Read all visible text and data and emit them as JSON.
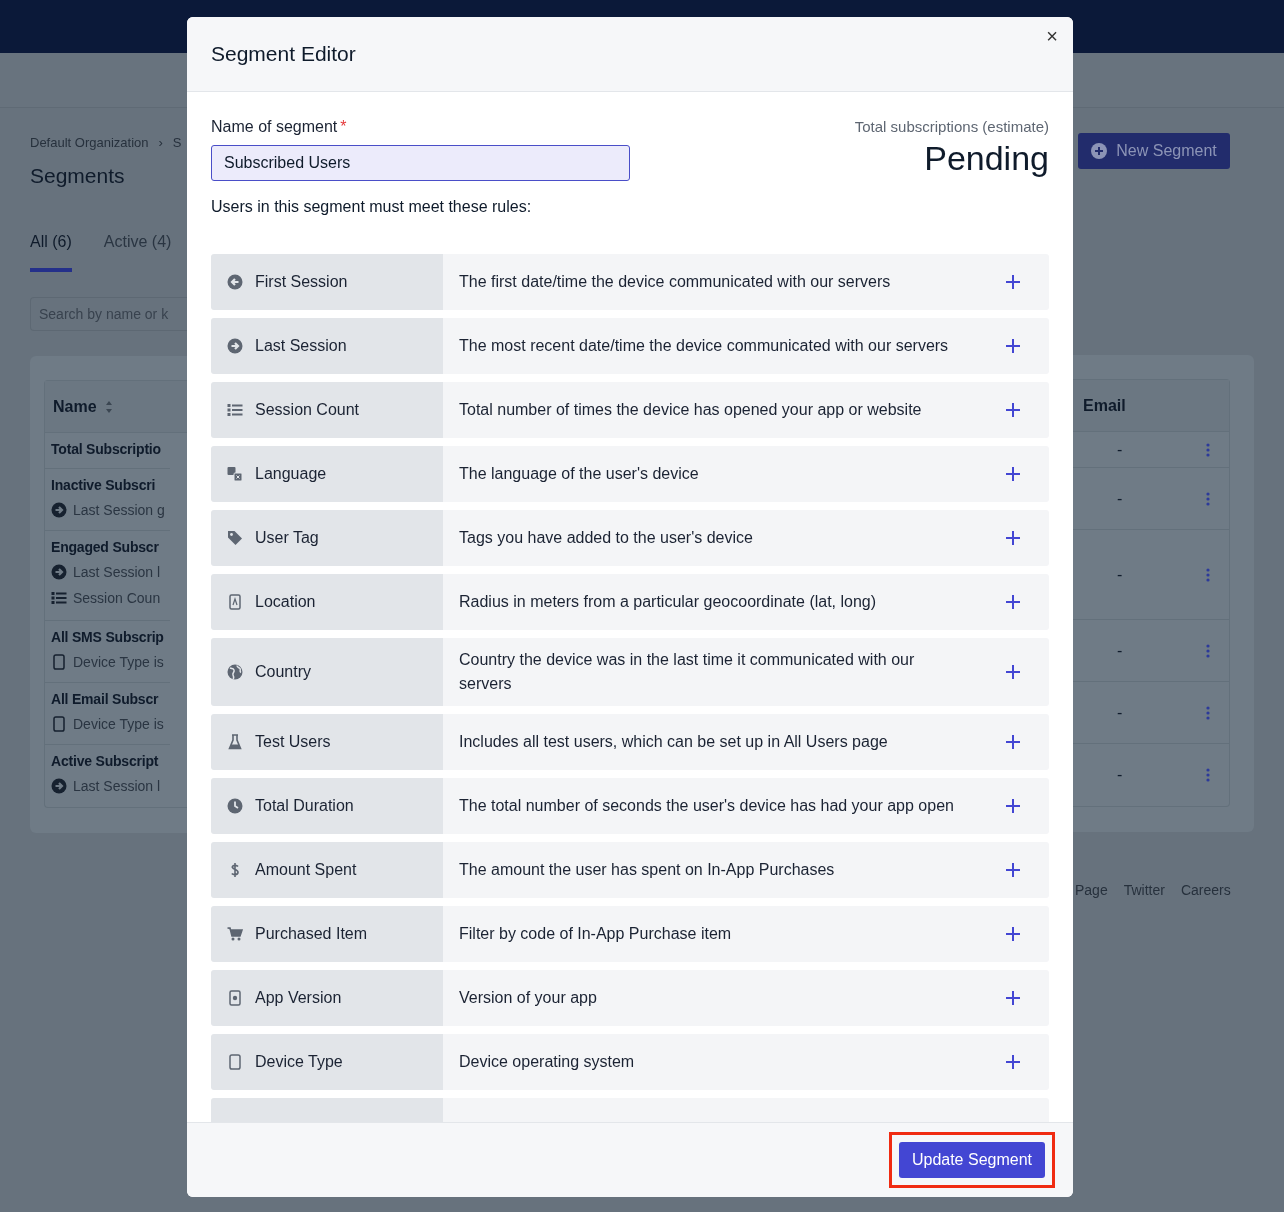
{
  "page": {
    "breadcrumb": [
      "Default Organization",
      "›",
      "S"
    ],
    "title": "Segments",
    "tabs": [
      {
        "label": "All (6)",
        "selected": true
      },
      {
        "label": "Active (4)",
        "selected": false
      }
    ],
    "search": {
      "placeholder": "Search by name or k"
    },
    "new_button": "New Segment",
    "table": {
      "columns": [
        "Name",
        "Email"
      ],
      "rows": [
        {
          "name": "Total Subscriptio",
          "conditions": [],
          "email": "-"
        },
        {
          "name": "Inactive Subscri",
          "conditions": [
            {
              "kind": "last-session",
              "text": "Last Session g"
            }
          ],
          "email": "-"
        },
        {
          "name": "Engaged Subscr",
          "conditions": [
            {
              "kind": "last-session",
              "text": "Last Session l"
            },
            {
              "kind": "session-count",
              "text": "Session Coun"
            }
          ],
          "email": "-"
        },
        {
          "name": "All SMS Subscrip",
          "conditions": [
            {
              "kind": "device-type",
              "text": "Device Type is"
            }
          ],
          "email": "-"
        },
        {
          "name": "All Email Subscr",
          "conditions": [
            {
              "kind": "device-type",
              "text": "Device Type is"
            }
          ],
          "email": "-"
        },
        {
          "name": "Active Subscript",
          "conditions": [
            {
              "kind": "last-session",
              "text": "Last Session l"
            }
          ],
          "email": "-"
        }
      ]
    },
    "footer_links": [
      "Page",
      "Twitter",
      "Careers"
    ]
  },
  "modal": {
    "title": "Segment Editor",
    "close": "×",
    "name_label": "Name of segment",
    "required_mark": "*",
    "name_value": "Subscribed Users",
    "estimate_label": "Total subscriptions (estimate)",
    "estimate_value": "Pending",
    "rules_intro": "Users in this segment must meet these rules:",
    "rules": [
      {
        "kind": "first-session",
        "name": "First Session",
        "description": "The first date/time the device communicated with our servers"
      },
      {
        "kind": "last-session",
        "name": "Last Session",
        "description": "The most recent date/time the device communicated with our servers"
      },
      {
        "kind": "session-count",
        "name": "Session Count",
        "description": "Total number of times the device has opened your app or website"
      },
      {
        "kind": "language",
        "name": "Language",
        "description": "The language of the user's device"
      },
      {
        "kind": "user-tag",
        "name": "User Tag",
        "description": "Tags you have added to the user's device"
      },
      {
        "kind": "location",
        "name": "Location",
        "description": "Radius in meters from a particular geocoordinate (lat, long)"
      },
      {
        "kind": "country",
        "name": "Country",
        "description": "Country the device was in the last time it communicated with our servers"
      },
      {
        "kind": "test-users",
        "name": "Test Users",
        "description": "Includes all test users, which can be set up in All Users page"
      },
      {
        "kind": "total-duration",
        "name": "Total Duration",
        "description": "The total number of seconds the user's device has had your app open"
      },
      {
        "kind": "amount-spent",
        "name": "Amount Spent",
        "description": "The amount the user has spent on In-App Purchases"
      },
      {
        "kind": "purchased-item",
        "name": "Purchased Item",
        "description": "Filter by code of In-App Purchase item"
      },
      {
        "kind": "app-version",
        "name": "App Version",
        "description": "Version of your app"
      },
      {
        "kind": "device-type",
        "name": "Device Type",
        "description": "Device operating system"
      }
    ],
    "submit": {
      "label": "Update Segment",
      "highlighted": true
    }
  }
}
